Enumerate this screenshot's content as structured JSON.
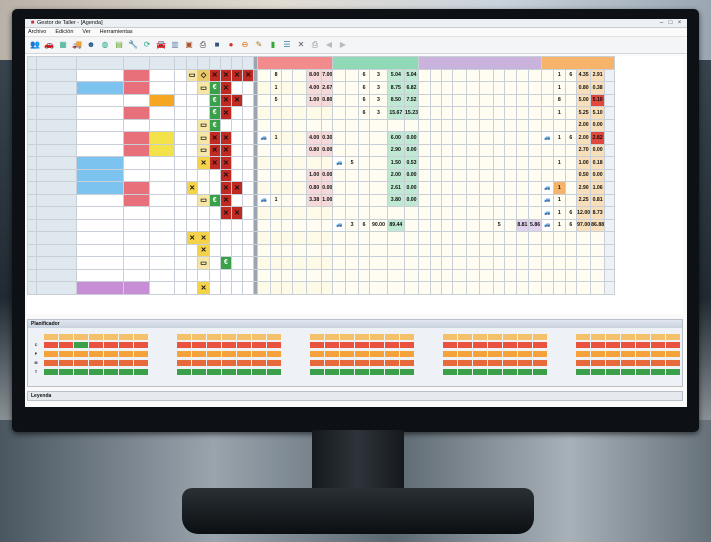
{
  "window": {
    "title": "Gestor de Taller - [Agenda]"
  },
  "menu": [
    "Archivo",
    "Edición",
    "Ver",
    "Herramientas"
  ],
  "toolbar_icons": [
    "users-icon",
    "car-icon",
    "calendar-icon",
    "truck-icon",
    "person-icon",
    "globe-icon",
    "chart-icon",
    "wrench-icon",
    "refresh-icon",
    "car-red-icon",
    "report-icon",
    "book-icon",
    "print-icon",
    "save-icon",
    "stop-icon",
    "minus-icon",
    "edit-icon",
    "trash-icon",
    "list-icon",
    "close-icon",
    "printer-icon",
    "back-icon",
    "forward-icon"
  ],
  "columns": {
    "matricula": "MATRÍCULA",
    "modelo": "MODELO",
    "entra": "ENTRA",
    "sale": "SALE",
    "n": "Nº",
    "e": "E",
    "p": "P",
    "r": "R",
    "f": "F",
    "o": "O",
    "ee": "E"
  },
  "sections": {
    "chapa": "CHAPA",
    "pintura": "PINTURA",
    "mecanica": "MECÁNICA",
    "montaje": "MONTAJE"
  },
  "rows": [
    {
      "num": "1",
      "mat": "5868DBH",
      "mod": "Nissan Terrano",
      "ent": "24/11/15",
      "sal": "01/12/15",
      "n": "",
      "modc": "#ffffff",
      "entc": "#e8707a",
      "salc": "#ffffff",
      "ch": [
        "",
        "8",
        "",
        "8.00",
        "7.00"
      ],
      "pi": [
        "",
        "",
        "6",
        "3",
        "5.04",
        "5.04"
      ],
      "mo": [
        "",
        "1",
        "6",
        "4.35",
        "2.91"
      ]
    },
    {
      "num": "2",
      "mat": "5844GHG",
      "mod": "Fiat Scudo",
      "ent": "21/12/15",
      "sal": "24/12/15",
      "n": "",
      "modc": "#7cc4ef",
      "entc": "#e8707a",
      "salc": "#ffffff",
      "ch": [
        "",
        "1",
        "",
        "4.00",
        "2.67"
      ],
      "pi": [
        "",
        "",
        "6",
        "3",
        "8.75",
        "6.82"
      ],
      "mo": [
        "",
        "1",
        "",
        "0.80",
        "0.38"
      ]
    },
    {
      "num": "3",
      "mat": "1101FDY",
      "mod": "Toyota RAV4",
      "ent": "24/12/15",
      "sal": "28/01/16",
      "n": "33",
      "modc": "#ffffff",
      "entc": "#ffffff",
      "salc": "#f5a623",
      "ch": [
        "",
        "5",
        "",
        "1.00",
        "0.80"
      ],
      "pi": [
        "",
        "",
        "6",
        "3",
        "8.50",
        "7.52"
      ],
      "mo": [
        "",
        "8",
        "",
        "5.00",
        "5.10"
      ]
    },
    {
      "num": "4",
      "mat": "9049HKH",
      "mod": "Hyundai i30",
      "ent": "28/01/16",
      "sal": "01/02/16",
      "n": "",
      "modc": "#ffffff",
      "entc": "#e8707a",
      "salc": "#ffffff",
      "ch": [
        "",
        "",
        "",
        "",
        ""
      ],
      "pi": [
        "",
        "",
        "6",
        "3",
        "15.67",
        "15.23"
      ],
      "mo": [
        "",
        "1",
        "",
        "5.25",
        "5.10"
      ]
    },
    {
      "num": "5",
      "mat": "3081HVF",
      "mod": "Dacia Sandero",
      "ent": "01/02/16",
      "sal": "02/02/16",
      "n": "24",
      "modc": "#ffffff",
      "entc": "#ffffff",
      "salc": "#ffffff",
      "ch": [
        "",
        "",
        "",
        "",
        ""
      ],
      "pi": [
        "",
        "",
        "",
        "",
        "",
        ""
      ],
      "mo": [
        "",
        "",
        "",
        "2.00",
        "0.00"
      ]
    },
    {
      "num": "6",
      "mat": "4312HWX",
      "mod": "Toyota Auris",
      "ent": "28/01/16",
      "sal": "02/02/16",
      "n": "",
      "modc": "#ffffff",
      "entc": "#e8707a",
      "salc": "#f4e24a",
      "ch": [
        "car",
        "1",
        "",
        "4.00",
        "0.30"
      ],
      "pi": [
        "",
        "",
        "",
        "",
        "6.00",
        "0.00"
      ],
      "mo": [
        "car",
        "1",
        "6",
        "2.00",
        "2.82"
      ]
    },
    {
      "num": "7",
      "mat": "2732HNZ",
      "mod": "Volskwagen Cadd",
      "ent": "01/02/16",
      "sal": "02/02/16",
      "n": "",
      "modc": "#ffffff",
      "entc": "#e8707a",
      "salc": "#f4e24a",
      "ch": [
        "",
        "",
        "",
        "0.80",
        "0.00"
      ],
      "pi": [
        "",
        "",
        "",
        "",
        "2.90",
        "0.00"
      ],
      "mo": [
        "",
        "",
        "",
        "2.70",
        "0.00"
      ]
    },
    {
      "num": "8",
      "mat": "0630BZD",
      "mod": "Opel Astra",
      "ent": "28/01/16",
      "sal": "03/02/16",
      "n": "40",
      "modc": "#7cc4ef",
      "entc": "#ffffff",
      "salc": "#ffffff",
      "ch": [
        "",
        "",
        "",
        "",
        ""
      ],
      "pi": [
        "car",
        "5",
        "",
        "",
        "1.50",
        "0.53"
      ],
      "mo": [
        "",
        "1",
        "",
        "1.00",
        "0.18"
      ]
    },
    {
      "num": "9",
      "mat": "4318FVY",
      "mod": "Volskwagen Golf",
      "ent": "01/02/16",
      "sal": "04/02/16",
      "n": "",
      "modc": "#7cc4ef",
      "entc": "#ffffff",
      "salc": "#ffffff",
      "ch": [
        "",
        "",
        "",
        "1.00",
        "0.00"
      ],
      "pi": [
        "",
        "",
        "",
        "",
        "2.00",
        "0.00"
      ],
      "mo": [
        "",
        "",
        "",
        "0.50",
        "0.00"
      ]
    },
    {
      "num": "10",
      "mat": "5921FWP",
      "mod": "Seat Altea",
      "ent": "28/01/16",
      "sal": "05/02/16",
      "n": "32",
      "modc": "#7cc4ef",
      "entc": "#e8707a",
      "salc": "#ffffff",
      "ch": [
        "",
        "",
        "",
        "0.80",
        "0.00"
      ],
      "pi": [
        "",
        "",
        "",
        "",
        "2.61",
        "0.00"
      ],
      "mo": [
        "car",
        "1",
        "",
        "2.90",
        "1.06"
      ]
    },
    {
      "num": "11",
      "mat": "2513CKP",
      "mod": "Peugeot 206",
      "ent": "28/01/16",
      "sal": "08/02/16",
      "n": "23",
      "modc": "#ffffff",
      "entc": "#e8707a",
      "salc": "#ffffff",
      "ch": [
        "car",
        "1",
        "",
        "3.38",
        "1.00"
      ],
      "pi": [
        "",
        "",
        "",
        "",
        "3.80",
        "0.00"
      ],
      "mo": [
        "car",
        "1",
        "",
        "2.25",
        "0.81"
      ]
    },
    {
      "num": "12",
      "mat": "6071GKN",
      "mod": "Ford Fiesta",
      "ent": "04/12/15",
      "sal": "09/02/16",
      "n": "",
      "modc": "#ffffff",
      "entc": "#ffffff",
      "salc": "#ffffff",
      "ch": [
        "",
        "",
        "",
        "",
        ""
      ],
      "pi": [
        "",
        "",
        "",
        "",
        "",
        ""
      ],
      "mo": [
        "car",
        "1",
        "6",
        "12.00",
        "8.73"
      ]
    },
    {
      "num": "13",
      "mat": "000000",
      "mod": "",
      "ent": "11/05/15",
      "sal": "25/02/16",
      "n": "",
      "modc": "#ffffff",
      "entc": "#ffffff",
      "salc": "#ffffff",
      "ch": [
        "",
        "",
        "",
        "",
        ""
      ],
      "pi": [
        "car",
        "3",
        "6",
        "90.00",
        "89.44"
      ],
      "mo": [
        "car",
        "1",
        "6",
        "97.00",
        "86.88"
      ]
    },
    {
      "num": "14",
      "mat": "5884CZS",
      "mod": "Mini Cooper",
      "ent": "26/01/17",
      "sal": "",
      "n": "",
      "modc": "#ffffff",
      "entc": "#ffffff",
      "salc": "#ffffff",
      "ch": [
        "",
        "",
        "",
        "",
        ""
      ],
      "pi": [
        "",
        "",
        "",
        "",
        "",
        ""
      ],
      "mo": [
        "",
        "",
        "",
        "",
        ""
      ]
    },
    {
      "num": "15",
      "mat": "4219CWG",
      "mod": "Citroën C5",
      "ent": "05/08/17",
      "sal": "",
      "n": "",
      "modc": "#ffffff",
      "entc": "#ffffff",
      "salc": "#ffffff",
      "ch": [
        "",
        "",
        "",
        "",
        ""
      ],
      "pi": [
        "",
        "",
        "",
        "",
        "",
        ""
      ],
      "mo": [
        "",
        "",
        "",
        "",
        ""
      ]
    },
    {
      "num": "16",
      "mat": "1735GVB",
      "mod": "Mercedes Vito",
      "ent": "08/05/17",
      "sal": "",
      "n": "",
      "modc": "#ffffff",
      "entc": "#ffffff",
      "salc": "#ffffff",
      "ch": [
        "",
        "",
        "",
        "",
        ""
      ],
      "pi": [
        "",
        "",
        "",
        "",
        "",
        ""
      ],
      "mo": [
        "",
        "",
        "",
        "",
        ""
      ]
    },
    {
      "num": "17",
      "mat": "1434DWR",
      "mod": "Citroën C4",
      "ent": "09/11/18",
      "sal": "",
      "n": "",
      "modc": "#ffffff",
      "entc": "#ffffff",
      "salc": "#ffffff",
      "ch": [
        "",
        "",
        "",
        "",
        ""
      ],
      "pi": [
        "",
        "",
        "",
        "",
        "",
        ""
      ],
      "mo": [
        "",
        "",
        "",
        "",
        ""
      ]
    },
    {
      "num": "18",
      "mat": "4953CRP",
      "mod": "Audi A4",
      "ent": "15/01/17",
      "sal": "",
      "n": "",
      "modc": "#c78ed6",
      "entc": "#c78ed6",
      "salc": "#ffffff",
      "ch": [
        "",
        "",
        "",
        "",
        ""
      ],
      "pi": [
        "",
        "",
        "",
        "",
        "",
        ""
      ],
      "mo": [
        "",
        "",
        "",
        "",
        ""
      ]
    }
  ],
  "mecanica_extra": {
    "row": "13",
    "values": [
      "5",
      "8.81",
      "5.86"
    ]
  },
  "planificador": {
    "title": "Planificador",
    "row_labels": [
      "C",
      "P",
      "M",
      "T"
    ]
  },
  "leyenda": {
    "title": "Leyenda"
  },
  "colors": {
    "chapa": "#f28b8b",
    "pintura": "#8fd9b6",
    "mecanica": "#c9b3dd",
    "montaje": "#f6b46a",
    "status_green": "#3aa14a",
    "status_red": "#d9342b"
  }
}
